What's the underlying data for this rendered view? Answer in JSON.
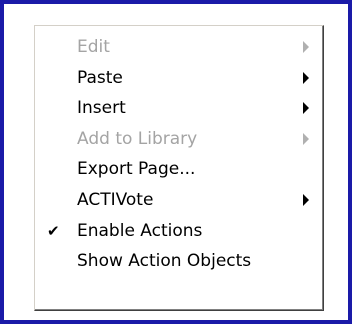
{
  "menu": {
    "items": [
      {
        "label": "Edit",
        "disabled": true,
        "submenu": true,
        "checked": false
      },
      {
        "label": "Paste",
        "disabled": false,
        "submenu": true,
        "checked": false
      },
      {
        "label": "Insert",
        "disabled": false,
        "submenu": true,
        "checked": false
      },
      {
        "label": "Add to Library",
        "disabled": true,
        "submenu": true,
        "checked": false
      },
      {
        "label": "Export Page...",
        "disabled": false,
        "submenu": false,
        "checked": false
      },
      {
        "label": "ACTIVote",
        "disabled": false,
        "submenu": true,
        "checked": false
      },
      {
        "label": "Enable Actions",
        "disabled": false,
        "submenu": false,
        "checked": true
      },
      {
        "label": "Show Action Objects",
        "disabled": false,
        "submenu": false,
        "checked": false
      }
    ]
  },
  "colors": {
    "frame_border": "#1a1aa8",
    "disabled_text": "#a4a4a4"
  }
}
